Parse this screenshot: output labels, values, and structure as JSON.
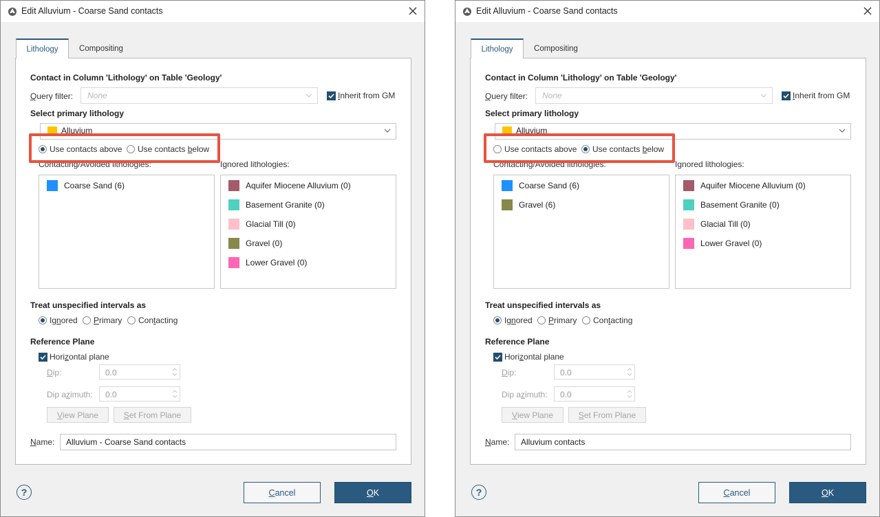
{
  "colors": {
    "accent": "#2b5a80",
    "highlight": "#e8533f",
    "alluvium": "#ffc400",
    "coarse_sand": "#1e90ff",
    "aquifer_miocene_alluvium": "#a35a6a",
    "basement_granite": "#4fd1bf",
    "glacial_till": "#ffc0cb",
    "gravel": "#87884b",
    "lower_gravel": "#ff66b3"
  },
  "dialogs": [
    {
      "title": "Edit Alluvium - Coarse Sand contacts",
      "tabs": [
        "Lithology",
        "Compositing"
      ],
      "contact_heading": "Contact in Column 'Lithology' on Table 'Geology'",
      "query_filter": {
        "label_pre": "",
        "label_u": "Q",
        "label_post": "uery filter:",
        "placeholder": "None",
        "inherit_pre": "",
        "inherit_u": "I",
        "inherit_post": "nherit from GM"
      },
      "primary": {
        "heading": "Select primary lithology",
        "value": "Alluvium",
        "swatch": "alluvium"
      },
      "radios": {
        "above": "Use contacts above",
        "below_pre": "Use contacts ",
        "below_u": "b",
        "below_post": "elow",
        "selected": "above"
      },
      "contacting_label": "Contacting/Avoided lithologies:",
      "ignored_label": "Ignored lithologies:",
      "contacting": [
        {
          "name": "Coarse Sand (6)",
          "swatch": "coarse_sand"
        }
      ],
      "ignored": [
        {
          "name": "Aquifer Miocene Alluvium (0)",
          "swatch": "aquifer_miocene_alluvium"
        },
        {
          "name": "Basement Granite (0)",
          "swatch": "basement_granite"
        },
        {
          "name": "Glacial Till (0)",
          "swatch": "glacial_till"
        },
        {
          "name": "Gravel (0)",
          "swatch": "gravel"
        },
        {
          "name": "Lower Gravel (0)",
          "swatch": "lower_gravel"
        }
      ],
      "treat": {
        "heading": "Treat unspecified intervals as",
        "ignored_pre": "Ig",
        "ignored_u": "n",
        "ignored_post": "ored",
        "primary_pre": "",
        "primary_u": "P",
        "primary_post": "rimary",
        "contacting_pre": "Con",
        "contacting_u": "t",
        "contacting_post": "acting",
        "selected": "ignored"
      },
      "reference": {
        "heading": "Reference Plane",
        "horizontal_pre": "Hori",
        "horizontal_u": "z",
        "horizontal_post": "ontal plane",
        "dip_label_u": "D",
        "dip_label_post": "ip:",
        "dip_value": "0.0",
        "azimuth_pre": "Dip a",
        "azimuth_u": "z",
        "azimuth_post": "imuth:",
        "azimuth_value": "0.0",
        "view_plane_pre": "",
        "view_plane_u": "V",
        "view_plane_post": "iew Plane",
        "set_from_plane_pre": "",
        "set_from_plane_u": "S",
        "set_from_plane_post": "et From Plane"
      },
      "name": {
        "label_u": "N",
        "label_post": "ame:",
        "value": "Alluvium - Coarse Sand contacts"
      },
      "buttons": {
        "help": "?",
        "cancel_u": "C",
        "cancel_post": "ancel",
        "ok_u": "O",
        "ok_post": "K"
      }
    },
    {
      "title": "Edit Alluvium - Coarse Sand contacts",
      "tabs": [
        "Lithology",
        "Compositing"
      ],
      "contact_heading": "Contact in Column 'Lithology' on Table 'Geology'",
      "query_filter": {
        "label_pre": "",
        "label_u": "Q",
        "label_post": "uery filter:",
        "placeholder": "None",
        "inherit_pre": "",
        "inherit_u": "I",
        "inherit_post": "nherit from GM"
      },
      "primary": {
        "heading": "Select primary lithology",
        "value": "Alluvium",
        "swatch": "alluvium"
      },
      "radios": {
        "above": "Use contacts above",
        "below_pre": "Use contacts ",
        "below_u": "b",
        "below_post": "elow",
        "selected": "below"
      },
      "contacting_label": "Contacting/Avoided lithologies:",
      "ignored_label": "Ignored lithologies:",
      "contacting": [
        {
          "name": "Coarse Sand (6)",
          "swatch": "coarse_sand"
        },
        {
          "name": "Gravel (6)",
          "swatch": "gravel"
        }
      ],
      "ignored": [
        {
          "name": "Aquifer Miocene Alluvium (0)",
          "swatch": "aquifer_miocene_alluvium"
        },
        {
          "name": "Basement Granite (0)",
          "swatch": "basement_granite"
        },
        {
          "name": "Glacial Till (0)",
          "swatch": "glacial_till"
        },
        {
          "name": "Lower Gravel (0)",
          "swatch": "lower_gravel"
        }
      ],
      "treat": {
        "heading": "Treat unspecified intervals as",
        "ignored_pre": "Ig",
        "ignored_u": "n",
        "ignored_post": "ored",
        "primary_pre": "",
        "primary_u": "P",
        "primary_post": "rimary",
        "contacting_pre": "Con",
        "contacting_u": "t",
        "contacting_post": "acting",
        "selected": "ignored"
      },
      "reference": {
        "heading": "Reference Plane",
        "horizontal_pre": "Hori",
        "horizontal_u": "z",
        "horizontal_post": "ontal plane",
        "dip_label_u": "D",
        "dip_label_post": "ip:",
        "dip_value": "0.0",
        "azimuth_pre": "Dip a",
        "azimuth_u": "z",
        "azimuth_post": "imuth:",
        "azimuth_value": "0.0",
        "view_plane_pre": "",
        "view_plane_u": "V",
        "view_plane_post": "iew Plane",
        "set_from_plane_pre": "",
        "set_from_plane_u": "S",
        "set_from_plane_post": "et From Plane"
      },
      "name": {
        "label_u": "N",
        "label_post": "ame:",
        "value": "Alluvium contacts"
      },
      "buttons": {
        "help": "?",
        "cancel_u": "C",
        "cancel_post": "ancel",
        "ok_u": "O",
        "ok_post": "K"
      }
    }
  ]
}
